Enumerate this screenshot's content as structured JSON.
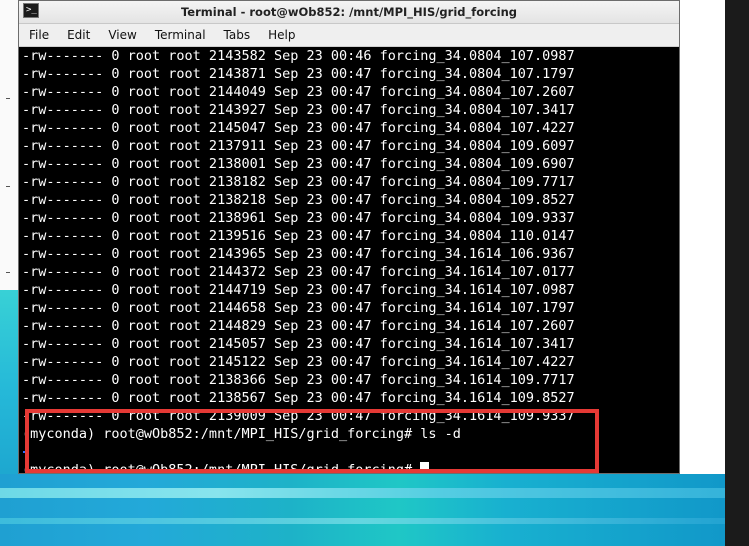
{
  "window": {
    "title": "Terminal - root@wOb852: /mnt/MPI_HIS/grid_forcing",
    "app_icon": "terminal-icon"
  },
  "menu": [
    "File",
    "Edit",
    "View",
    "Terminal",
    "Tabs",
    "Help"
  ],
  "terminal": {
    "lines": [
      "-rw------- 0 root root 2143582 Sep 23 00:46 forcing_34.0804_107.0987",
      "-rw------- 0 root root 2143871 Sep 23 00:47 forcing_34.0804_107.1797",
      "-rw------- 0 root root 2144049 Sep 23 00:47 forcing_34.0804_107.2607",
      "-rw------- 0 root root 2143927 Sep 23 00:47 forcing_34.0804_107.3417",
      "-rw------- 0 root root 2145047 Sep 23 00:47 forcing_34.0804_107.4227",
      "-rw------- 0 root root 2137911 Sep 23 00:47 forcing_34.0804_109.6097",
      "-rw------- 0 root root 2138001 Sep 23 00:47 forcing_34.0804_109.6907",
      "-rw------- 0 root root 2138182 Sep 23 00:47 forcing_34.0804_109.7717",
      "-rw------- 0 root root 2138218 Sep 23 00:47 forcing_34.0804_109.8527",
      "-rw------- 0 root root 2138961 Sep 23 00:47 forcing_34.0804_109.9337",
      "-rw------- 0 root root 2139516 Sep 23 00:47 forcing_34.0804_110.0147",
      "-rw------- 0 root root 2143965 Sep 23 00:47 forcing_34.1614_106.9367",
      "-rw------- 0 root root 2144372 Sep 23 00:47 forcing_34.1614_107.0177",
      "-rw------- 0 root root 2144719 Sep 23 00:47 forcing_34.1614_107.0987",
      "-rw------- 0 root root 2144658 Sep 23 00:47 forcing_34.1614_107.1797",
      "-rw------- 0 root root 2144829 Sep 23 00:47 forcing_34.1614_107.2607",
      "-rw------- 0 root root 2145057 Sep 23 00:47 forcing_34.1614_107.3417",
      "-rw------- 0 root root 2145122 Sep 23 00:47 forcing_34.1614_107.4227",
      "-rw------- 0 root root 2138366 Sep 23 00:47 forcing_34.1614_109.7717",
      "-rw------- 0 root root 2138567 Sep 23 00:47 forcing_34.1614_109.8527",
      "-rw------- 0 root root 2139009 Sep 23 00:47 forcing_34.1614_109.9337",
      "(myconda) root@wOb852:/mnt/MPI_HIS/grid_forcing# ls -d",
      "",
      "(myconda) root@wOb852:/mnt/MPI_HIS/grid_forcing# "
    ]
  },
  "colors": {
    "terminal_background": "#000000",
    "terminal_text": "#ffffff",
    "highlight_border": "#e53935"
  }
}
